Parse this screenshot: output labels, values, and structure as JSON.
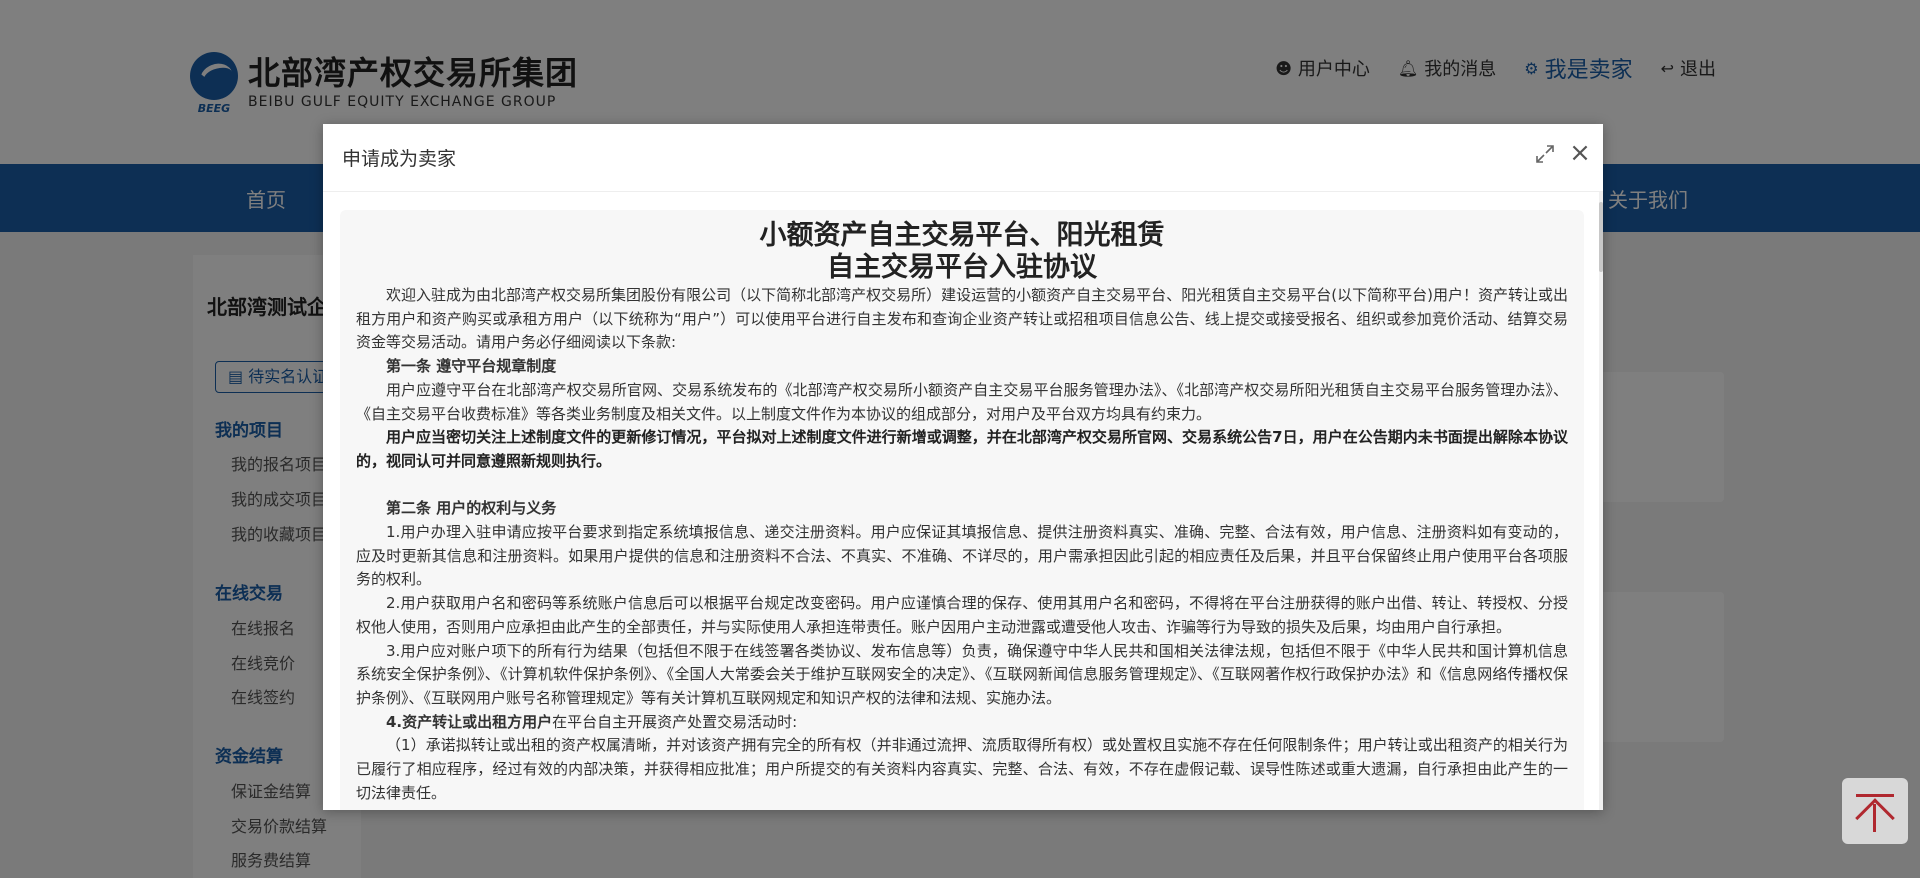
{
  "header": {
    "logo": {
      "mark_text": "BEEG",
      "name_cn": "北部湾产权交易所集团",
      "name_en": "BEIBU GULF EQUITY EXCHANGE GROUP"
    },
    "links": [
      {
        "icon": "user-circle-icon",
        "label": "用户中心"
      },
      {
        "icon": "bell-icon",
        "label": "我的消息"
      },
      {
        "icon": "seller-icon",
        "label": "我是卖家"
      },
      {
        "icon": "logout-icon",
        "label": "退出"
      }
    ]
  },
  "nav": {
    "items": [
      "首页",
      "关于我们"
    ]
  },
  "sidebar": {
    "company_name": "北部湾测试企业",
    "verify_badge": "待实名认证",
    "groups": [
      {
        "title": "我的项目",
        "items": [
          "我的报名项目",
          "我的成交项目",
          "我的收藏项目"
        ]
      },
      {
        "title": "在线交易",
        "items": [
          "在线报名",
          "在线竞价",
          "在线签约"
        ]
      },
      {
        "title": "资金结算",
        "items": [
          "保证金结算",
          "交易价款结算",
          "服务费结算"
        ]
      }
    ]
  },
  "modal": {
    "title": "申请成为卖家",
    "doc_title_line1": "小额资产自主交易平台、阳光租赁",
    "doc_title_line2": "自主交易平台入驻协议",
    "paragraphs": {
      "intro": "欢迎入驻成为由北部湾产权交易所集团股份有限公司（以下简称北部湾产权交易所）建设运营的小额资产自主交易平台、阳光租赁自主交易平台(以下简称平台)用户！资产转让或出租方用户和资产购买或承租方用户（以下统称为“用户”）可以使用平台进行自主发布和查询企业资产转让或招租项目信息公告、线上提交或接受报名、组织或参加竞价活动、结算交易资金等交易活动。请用户务必仔细阅读以下条款:",
      "art1_title": "第一条 遵守平台规章制度",
      "art1_p1": "用户应遵守平台在北部湾产权交易所官网、交易系统发布的《北部湾产权交易所小额资产自主交易平台服务管理办法》、《北部湾产权交易所阳光租赁自主交易平台服务管理办法》、《自主交易平台收费标准》等各类业务制度及相关文件。以上制度文件作为本协议的组成部分，对用户及平台双方均具有约束力。",
      "art1_p2": "用户应当密切关注上述制度文件的更新修订情况，平台拟对上述制度文件进行新增或调整，并在北部湾产权交易所官网、交易系统公告7日，用户在公告期内未书面提出解除本协议的，视同认可并同意遵照新规则执行。",
      "art2_title": "第二条 用户的权利与义务",
      "art2_p1": "1.用户办理入驻申请应按平台要求到指定系统填报信息、递交注册资料。用户应保证其填报信息、提供注册资料真实、准确、完整、合法有效，用户信息、注册资料如有变动的，应及时更新其信息和注册资料。如果用户提供的信息和注册资料不合法、不真实、不准确、不详尽的，用户需承担因此引起的相应责任及后果，并且平台保留终止用户使用平台各项服务的权利。",
      "art2_p2": "2.用户获取用户名和密码等系统账户信息后可以根据平台规定改变密码。用户应谨慎合理的保存、使用其用户名和密码，不得将在平台注册获得的账户出借、转让、转授权、分授权他人使用，否则用户应承担由此产生的全部责任，并与实际使用人承担连带责任。账户因用户主动泄露或遭受他人攻击、诈骗等行为导致的损失及后果，均由用户自行承担。",
      "art2_p3": "3.用户应对账户项下的所有行为结果（包括但不限于在线签署各类协议、发布信息等）负责，确保遵守中华人民共和国相关法律法规，包括但不限于《中华人民共和国计算机信息系统安全保护条例》、《计算机软件保护条例》、《全国人大常委会关于维护互联网安全的决定》、《互联网新闻信息服务管理规定》、《互联网著作权行政保护办法》和《信息网络传播权保护条例》、《互联网用户账号名称管理规定》等有关计算机互联网规定和知识产权的法律和法规、实施办法。",
      "art2_p4_bold": "4.资产转让或出租方用户",
      "art2_p4_rest": "在平台自主开展资产处置交易活动时:",
      "art2_p4_1": "（1）承诺拟转让或出租的资产权属清晰，并对该资产拥有完全的所有权（并非通过流押、流质取得所有权）或处置权且实施不存在任何限制条件；用户转让或出租资产的相关行为已履行了相应程序，经过有效的内部决策，并获得相应批准；用户所提交的有关资料内容真实、完整、合法、有效，不存在虚假记载、误导性陈述或重大遗漏，自行承担由此产生的一切法律责任。"
    }
  }
}
